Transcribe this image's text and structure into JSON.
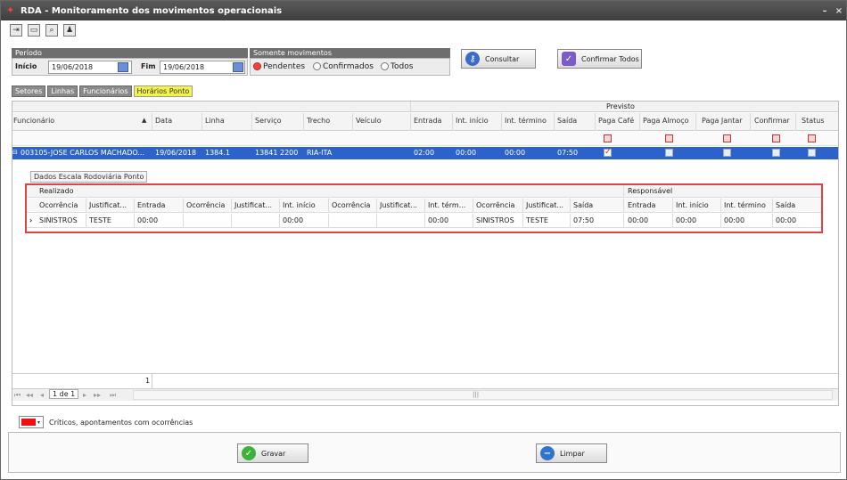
{
  "window": {
    "title": "RDA - Monitoramento dos movimentos operacionais",
    "controls": [
      "–",
      "×"
    ]
  },
  "toolbar": {
    "icons": [
      "exit-icon",
      "screen-icon",
      "search-icon",
      "users-icon"
    ]
  },
  "periodo": {
    "header": "Período",
    "inicio_label": "Início",
    "inicio_value": "19/06/2018",
    "fim_label": "Fim",
    "fim_value": "19/06/2018"
  },
  "movimentos": {
    "header": "Somente movimentos",
    "options": [
      "Pendentes",
      "Confirmados",
      "Todos"
    ],
    "selected": "Pendentes"
  },
  "buttons": {
    "consultar": "Consultar",
    "confirmar_todos": "Confirmar Todos",
    "gravar": "Gravar",
    "limpar": "Limpar"
  },
  "tabs": [
    "Setores",
    "Linhas",
    "Funcionários",
    "Horários Ponto"
  ],
  "grid": {
    "group_label": "Previsto",
    "columns": [
      "Funcionário",
      "Data",
      "Linha",
      "Serviço",
      "Trecho",
      "Veículo",
      "Entrada",
      "Int. início",
      "Int. término",
      "Saída",
      "Paga Café",
      "Paga Almoço",
      "Paga Jantar",
      "Confirmar",
      "Status"
    ],
    "row": {
      "funcionario": "003105-JOSE CARLOS MACHADO...",
      "data": "19/06/2018",
      "linha": "1384.1",
      "servico": "13841 2200",
      "trecho": "RIA-ITA",
      "entrada": "02:00",
      "int_inicio": "00:00",
      "int_termino": "00:00",
      "saida": "07:50"
    },
    "footer_count": "1"
  },
  "detail": {
    "tab_label": "Dados Escala Rodoviária Ponto",
    "group_realizado": "Realizado",
    "group_responsavel": "Responsável",
    "columns": [
      "Ocorrência",
      "Justificat...",
      "Entrada",
      "Ocorrência",
      "Justificat...",
      "Int. início",
      "Ocorrência",
      "Justificat...",
      "Int. térm...",
      "Ocorrência",
      "Justificat...",
      "Saída",
      "Entrada",
      "Int. início",
      "Int. término",
      "Saída"
    ],
    "row": [
      "SINISTROS",
      "TESTE",
      "00:00",
      "",
      "",
      "00:00",
      "",
      "",
      "00:00",
      "SINISTROS",
      "TESTE",
      "07:50",
      "00:00",
      "00:00",
      "00:00",
      "00:00"
    ]
  },
  "pager": {
    "first": "⏮",
    "prev_page": "◂◂",
    "prev": "◂",
    "page_text": "1 de 1",
    "next": "▸",
    "next_page": "▸▸",
    "last": "⏭",
    "scroll_mid": "|||"
  },
  "legend": {
    "text": "Críticos, apontamentos com ocorrências",
    "color": "#e11111"
  },
  "colors": {
    "selection": "#2c62c9",
    "active_tab": "#f4f34a",
    "alert_border": "#dd4444"
  }
}
